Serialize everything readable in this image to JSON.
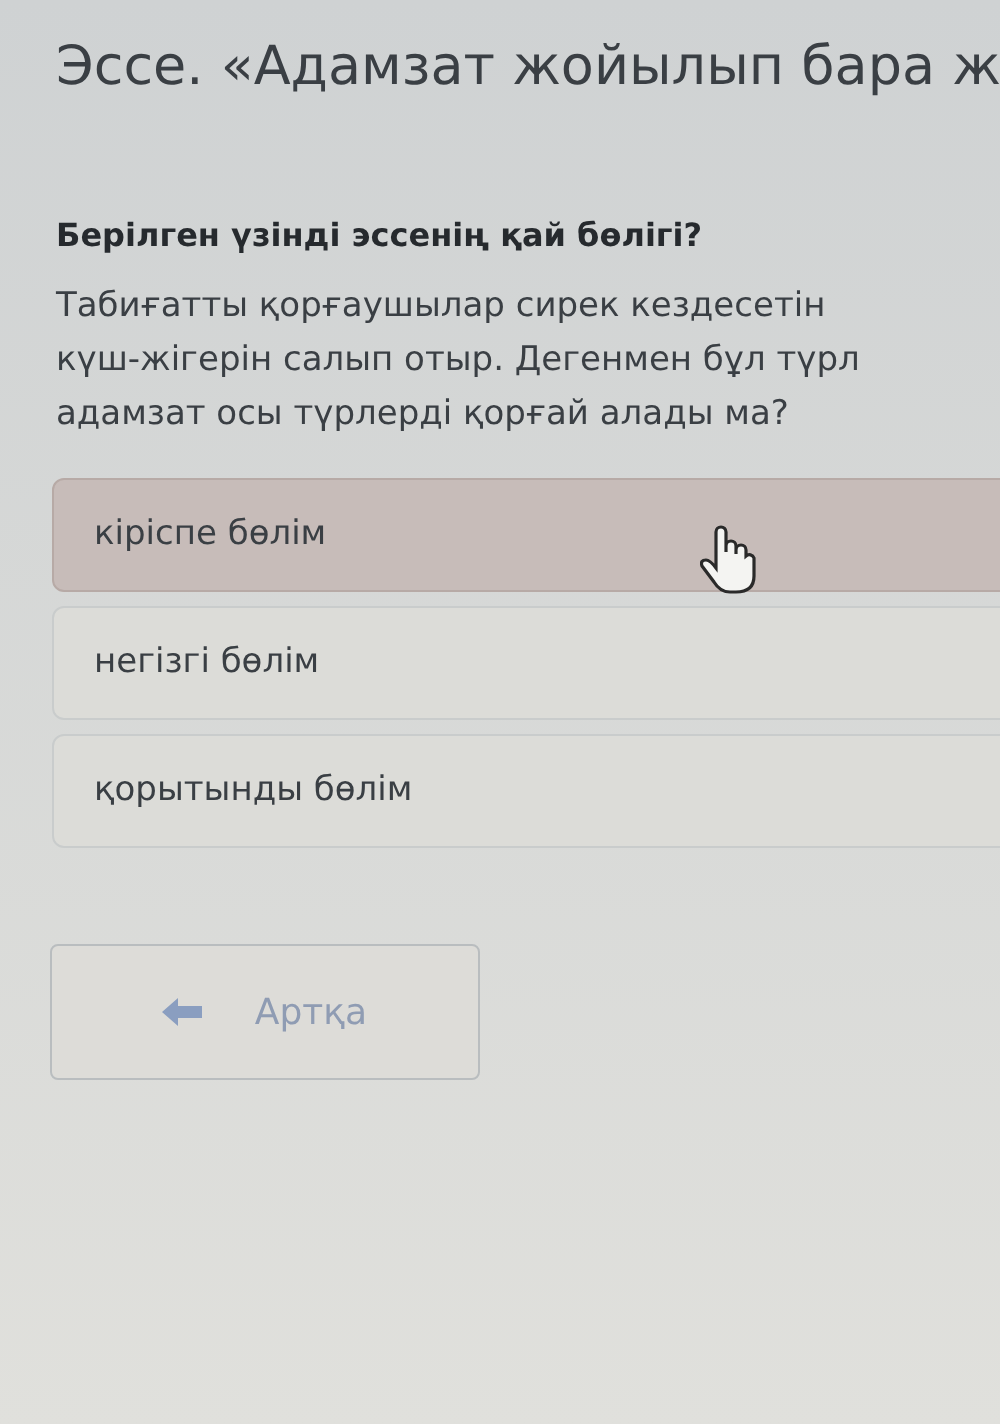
{
  "title": "Эссе. «Адамзат жойылып бара ж",
  "question": "Берілген үзінді эссенің қай бөлігі?",
  "passage_lines": [
    "Табиғатты қорғаушылар сирек кездесетін",
    "күш-жігерін салып отыр. Дегенмен бұл түрл",
    "адамзат осы түрлерді қорғай алады ма?"
  ],
  "options": [
    {
      "label": "кіріспе бөлім",
      "selected": true
    },
    {
      "label": "негізгі бөлім",
      "selected": false
    },
    {
      "label": "қорытынды бөлім",
      "selected": false
    }
  ],
  "back_button": {
    "label": "Артқа"
  }
}
